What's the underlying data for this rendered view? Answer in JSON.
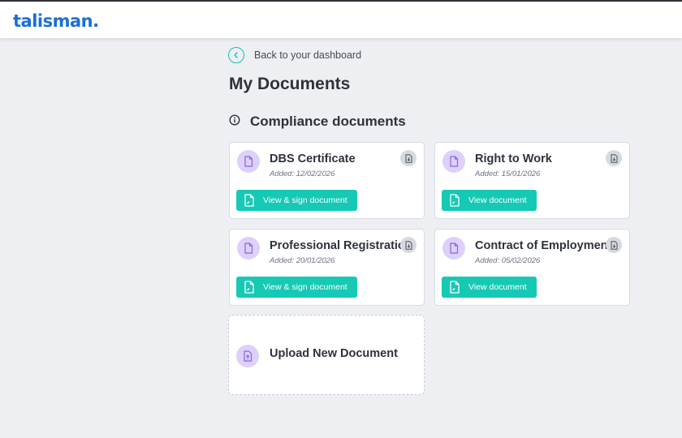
{
  "app": {
    "logo_text": "talisman.",
    "brand_color": "#1a6fd6",
    "accent_color": "#16c9b4"
  },
  "nav": {
    "back_label": "Back to your dashboard",
    "back_icon": "chevron-left-icon"
  },
  "page": {
    "title": "My Documents"
  },
  "section": {
    "title": "Compliance documents",
    "icon": "info-icon"
  },
  "documents": [
    {
      "name": "DBS Certificate",
      "added": "Added: 12/02/2026",
      "action_label": "View & sign document"
    },
    {
      "name": "Right to Work",
      "added": "Added: 15/01/2026",
      "action_label": "View document"
    },
    {
      "name": "Professional Registration",
      "added": "Added: 20/01/2026",
      "action_label": "View & sign document"
    },
    {
      "name": "Contract of Employment",
      "added": "Added: 05/02/2026",
      "action_label": "View document"
    }
  ],
  "upload": {
    "label": "Upload New Document",
    "icon": "document-upload-icon"
  }
}
